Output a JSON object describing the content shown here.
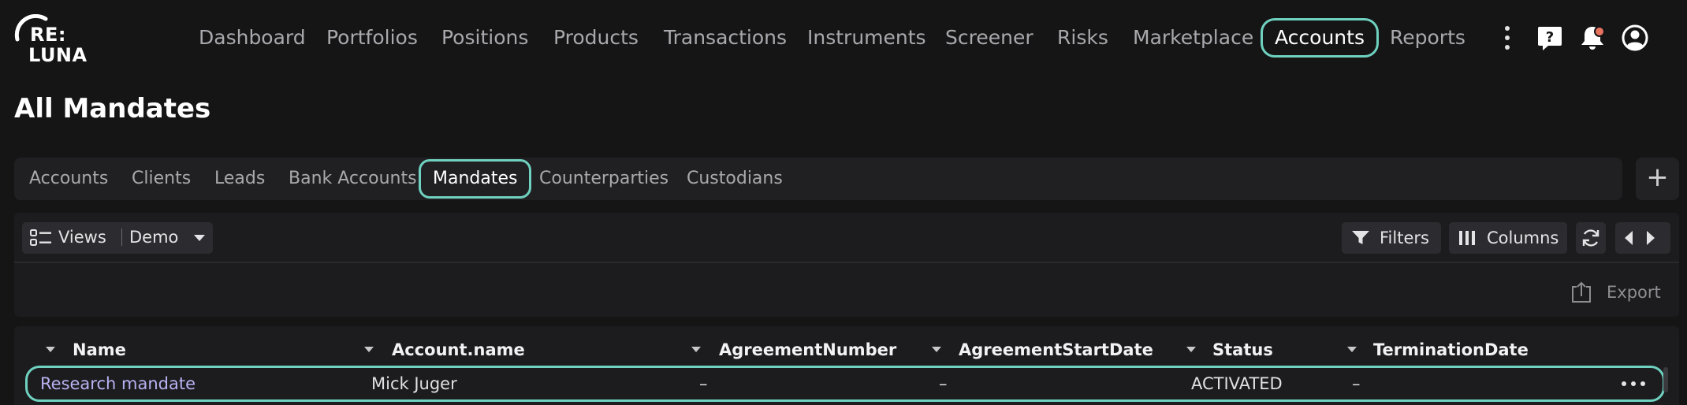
{
  "app": {
    "logo_line1": "RE:",
    "logo_line2": "LUNA"
  },
  "nav": {
    "items": [
      {
        "label": "Dashboard"
      },
      {
        "label": "Portfolios"
      },
      {
        "label": "Positions"
      },
      {
        "label": "Products"
      },
      {
        "label": "Transactions"
      },
      {
        "label": "Instruments"
      },
      {
        "label": "Screener"
      },
      {
        "label": "Risks"
      },
      {
        "label": "Marketplace"
      },
      {
        "label": "Accounts",
        "active": true
      },
      {
        "label": "Reports"
      }
    ],
    "icons": [
      "more-vertical-icon",
      "help-chat-icon",
      "bell-icon",
      "user-icon"
    ],
    "notification_dot_color": "#e8735f"
  },
  "page": {
    "title": "All Mandates"
  },
  "tabs": [
    {
      "label": "Accounts"
    },
    {
      "label": "Clients"
    },
    {
      "label": "Leads"
    },
    {
      "label": "Bank Accounts"
    },
    {
      "label": "Mandates",
      "active": true
    },
    {
      "label": "Counterparties"
    },
    {
      "label": "Custodians"
    }
  ],
  "toolbar": {
    "views_label": "Views",
    "view_name": "Demo",
    "filters_label": "Filters",
    "columns_label": "Columns",
    "export_label": "Export"
  },
  "table": {
    "columns": [
      "Name",
      "Account.name",
      "AgreementNumber",
      "AgreementStartDate",
      "Status",
      "TerminationDate"
    ],
    "rows": [
      {
        "name": "Research mandate",
        "account_name": "Mick Juger",
        "agreement_number": "–",
        "agreement_start_date": "–",
        "status": "ACTIVATED",
        "termination_date": "–"
      }
    ]
  },
  "colors": {
    "accent": "#6fd1bf",
    "background": "#151516",
    "panel": "#1c1c1f",
    "link": "#b8b2f2"
  }
}
